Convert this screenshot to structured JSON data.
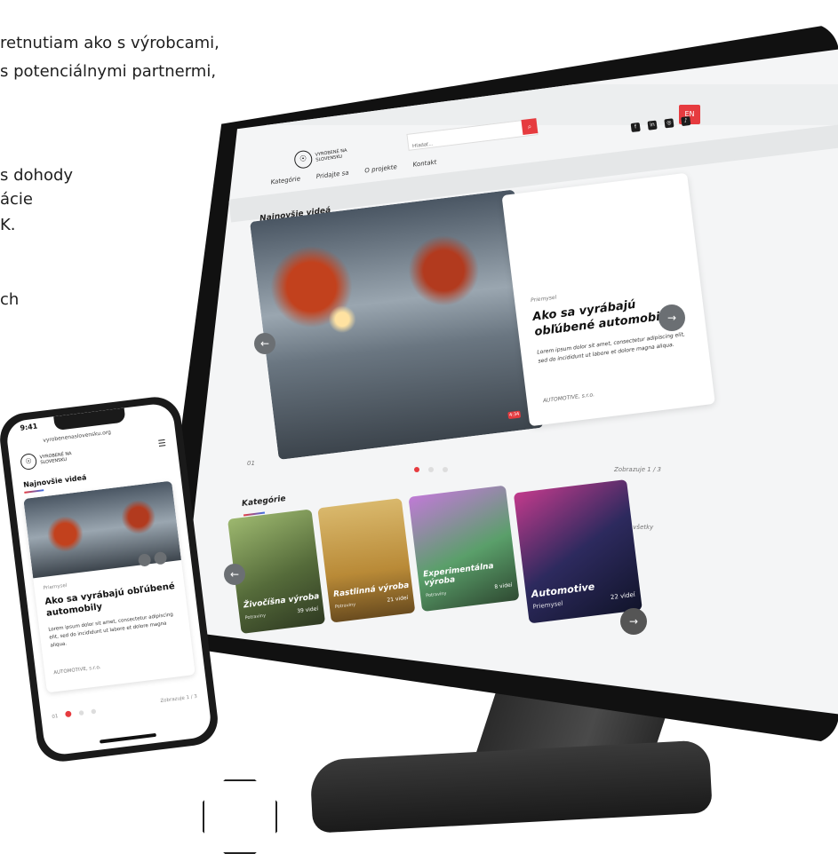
{
  "intro": {
    "lines": [
      "retnutiam ako s výrobcami,",
      "s potenciálnymi partnermi,",
      "s dohody",
      "ácie",
      "K.",
      "ch"
    ]
  },
  "desktop": {
    "lang": "EN",
    "search_placeholder": "Hľadať...",
    "search_icon": "search-icon",
    "socials": [
      "facebook-icon",
      "linkedin-icon",
      "instagram-icon",
      "tiktok-icon"
    ],
    "nav": [
      "Kategórie",
      "Pridajte sa",
      "O projekte",
      "Kontakt"
    ],
    "latest_title": "Najnovšie videá",
    "hero": {
      "tag": "Priemysel",
      "title": "Ako sa vyrábajú obľúbené automobily",
      "text": "Lorem ipsum dolor sit amet, consectetur adipiscing elit, sed do incididunt ut labore et dolore magna aliqua.",
      "meta": "AUTOMOTIVE, s.r.o.",
      "duration": "4:34"
    },
    "pager_left": "01",
    "pager_right": "Zobrazuje 1 / 3",
    "categories_title": "Kategórie",
    "show_all": "Zobraziť všetky",
    "categories": [
      {
        "title": "Živočíšna výroba",
        "sub": "Potraviny",
        "count": "39 videí"
      },
      {
        "title": "Rastlinná výroba",
        "sub": "Potraviny",
        "count": "21 videí"
      },
      {
        "title": "Experimentálna výroba",
        "sub": "Potraviny",
        "count": "8 videí"
      },
      {
        "title": "Automotive",
        "sub": "Priemysel",
        "count": "22 videí"
      }
    ]
  },
  "phone": {
    "time": "9:41",
    "url": "vyrobenenaslovensku.org",
    "logo_text": "VYROBENÉ NA SLOVENSKU",
    "title": "Najnovšie videá",
    "tag": "Priemysel",
    "heading": "Ako sa vyrábajú obľúbené automobily",
    "text": "Lorem ipsum dolor sit amet, consectetur adipiscing elit, sed do incididunt ut labore et dolore magna aliqua.",
    "meta": "AUTOMOTIVE, s.r.o.",
    "pager_left": "01",
    "pager_right": "Zobrazuje 1 / 3"
  },
  "colors": {
    "accent": "#e63b3f",
    "accent_blue": "#3b6fe6",
    "dark": "#111111"
  }
}
